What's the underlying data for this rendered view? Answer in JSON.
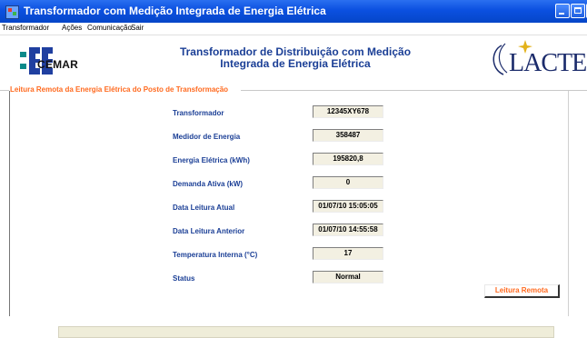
{
  "window": {
    "title": "Transformador com Medição Integrada de Energia Elétrica"
  },
  "menu": {
    "items": [
      "Transformador",
      "Ações",
      "Comunicação",
      "Sair"
    ]
  },
  "header": {
    "cemar_logo_text": "CEMAR",
    "title_line1": "Transformador de Distribuição  com Medição",
    "title_line2": "Integrada de Energia Elétrica",
    "lactec_logo_text": "LACTEC"
  },
  "group": {
    "title": "Leitura Remota da Energia Elétrica do Posto de Transformação"
  },
  "fields": [
    {
      "label": "Transformador",
      "value": "12345XY678"
    },
    {
      "label": "Medidor de Energia",
      "value": "358487"
    },
    {
      "label": "Energia Elétrica (kWh)",
      "value": "195820,8"
    },
    {
      "label": "Demanda Ativa (kW)",
      "value": "0"
    },
    {
      "label": "Data Leitura Atual",
      "value": "01/07/10 15:05:05"
    },
    {
      "label": "Data Leitura Anterior",
      "value": "01/07/10 14:55:58"
    },
    {
      "label": "Temperatura Interna (°C)",
      "value": "17"
    },
    {
      "label": "Status",
      "value": "Normal"
    }
  ],
  "buttons": {
    "leitura_remota": "Leitura Remota"
  },
  "colors": {
    "titlebar": "#0b50e0",
    "heading_blue": "#1b3f96",
    "accent_orange": "#ff6a1f",
    "field_bg": "#f3f0e2",
    "status_panel_bg": "#efedd9"
  }
}
